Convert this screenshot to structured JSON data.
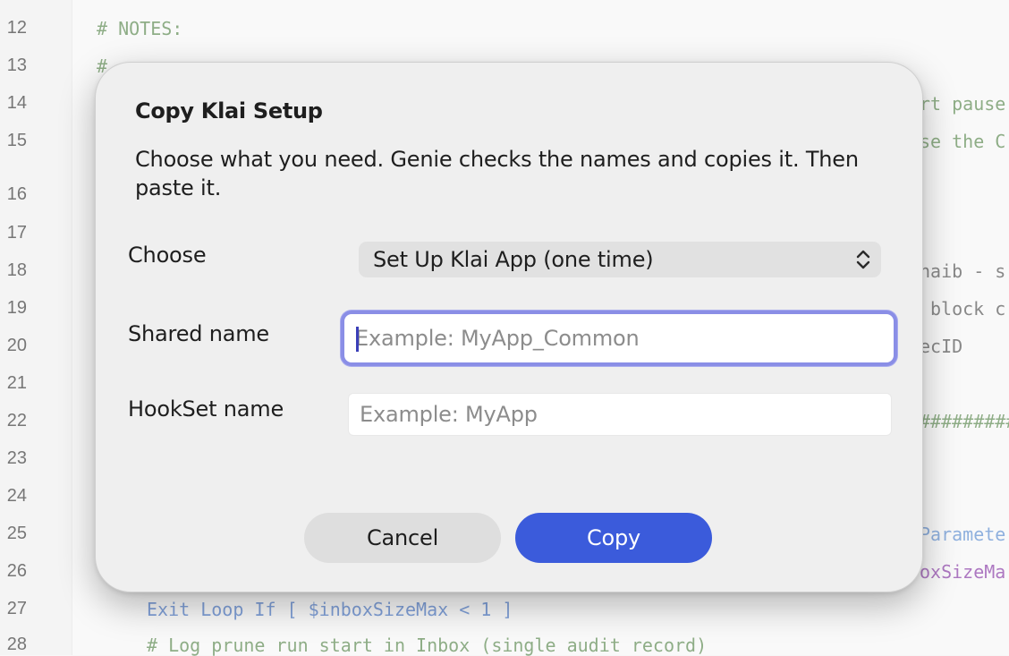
{
  "editor": {
    "line_numbers": [
      "12",
      "13",
      "14",
      "15",
      "16",
      "17",
      "18",
      "19",
      "20",
      "21",
      "22",
      "23",
      "24",
      "25",
      "26",
      "27",
      "28"
    ],
    "code": {
      "notes": "# NOTES:",
      "hash_13": "#",
      "frag_14": "rt pause",
      "frag_15": "se the C",
      "frag_18": "haib - s",
      "frag_19": "block c",
      "frag_20": "ecID",
      "frag_22": "#########",
      "frag_25": "Paramete",
      "frag_26": "oxSizeMa",
      "line_27": "Exit Loop If [ $inboxSizeMax < 1 ]",
      "line_28": "# Log prune run start in Inbox (single audit record)"
    }
  },
  "dialog": {
    "title": "Copy Klai Setup",
    "description": "Choose what you need. Genie checks the names and copies it. Then paste it.",
    "choose": {
      "label": "Choose",
      "selected": "Set Up Klai App (one time)"
    },
    "shared_name": {
      "label": "Shared name",
      "placeholder": "Example: MyApp_Common",
      "value": ""
    },
    "hookset_name": {
      "label": "HookSet name",
      "placeholder": "Example: MyApp",
      "value": ""
    },
    "buttons": {
      "cancel": "Cancel",
      "copy": "Copy"
    },
    "colors": {
      "primary": "#3b5bdb",
      "focus_ring": "#8a8ee6"
    },
    "icons": {
      "select": "chevron-up-down-icon"
    }
  }
}
